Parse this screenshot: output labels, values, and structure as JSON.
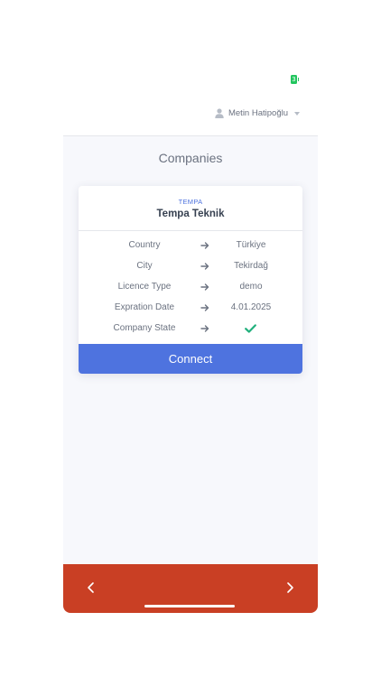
{
  "status_bar": {
    "battery_label": "3"
  },
  "header": {
    "user_name": "Metin Hatipoğlu"
  },
  "page": {
    "title": "Companies"
  },
  "company_card": {
    "code": "TEMPA",
    "name": "Tempa Teknik",
    "rows": [
      {
        "label": "Country",
        "value": "Türkiye"
      },
      {
        "label": "City",
        "value": "Tekirdağ"
      },
      {
        "label": "Licence Type",
        "value": "demo"
      },
      {
        "label": "Expration Date",
        "value": "4.01.2025"
      },
      {
        "label": "Company State",
        "value_icon": "check-icon"
      }
    ],
    "connect_label": "Connect"
  },
  "colors": {
    "accent": "#4e73df",
    "bottom_bar": "#c93f24",
    "state_ok": "#22c55e"
  }
}
